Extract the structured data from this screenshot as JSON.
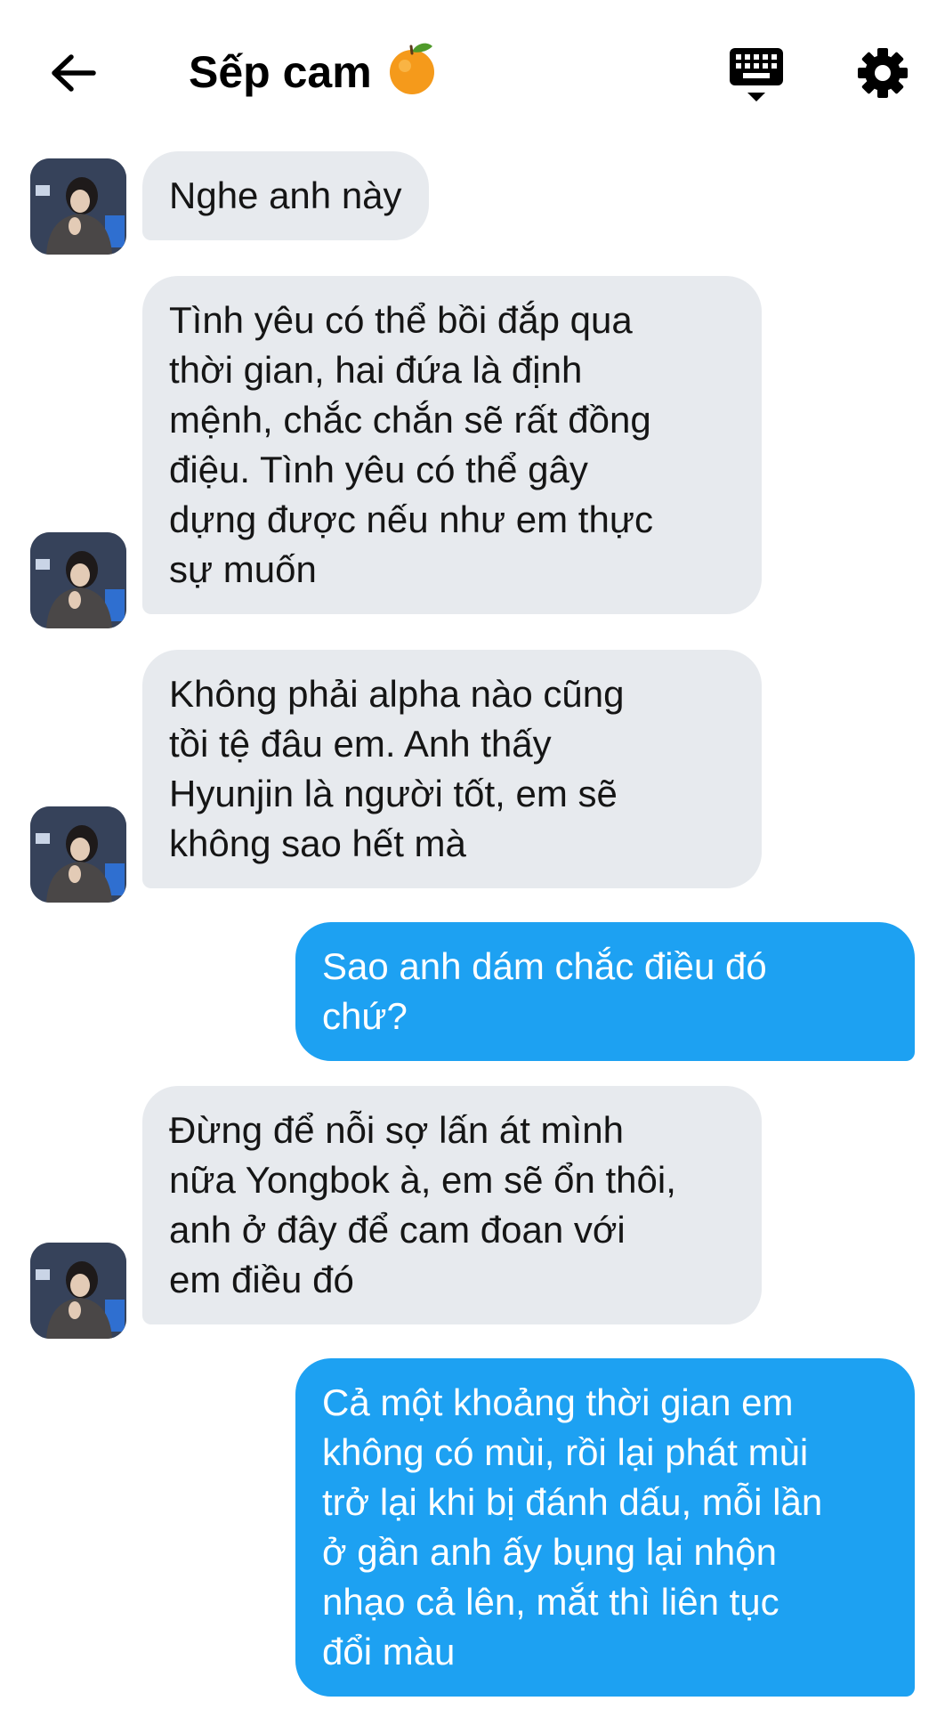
{
  "header": {
    "title": "Sếp cam",
    "back_icon": "arrow-left-icon",
    "emoji_icon": "orange-emoji-icon",
    "keyboard_icon": "keyboard-icon",
    "settings_icon": "gear-icon"
  },
  "colors": {
    "received_bubble": "#e7eaee",
    "sent_bubble": "#1da1f2",
    "background": "#ffffff"
  },
  "messages": [
    {
      "side": "received",
      "text": "Nghe anh này"
    },
    {
      "side": "received",
      "text": "Tình yêu có thể bồi đắp qua\nthời gian, hai đứa là định\nmệnh, chắc chắn sẽ rất đồng\nđiệu. Tình yêu có thể gây\ndựng được nếu như em thực\nsự muốn"
    },
    {
      "side": "received",
      "text": "Không phải alpha nào cũng\ntồi tệ đâu em. Anh thấy\nHyunjin là người tốt, em sẽ\nkhông sao hết mà"
    },
    {
      "side": "sent",
      "text": "Sao anh dám chắc điều đó\nchứ?"
    },
    {
      "side": "received",
      "text": "Đừng để nỗi sợ lấn át mình\nnữa Yongbok à, em sẽ ổn thôi,\nanh ở đây để cam đoan với\nem điều đó"
    },
    {
      "side": "sent",
      "text": "Cả một khoảng thời gian em\nkhông có mùi, rồi lại phát mùi\ntrở lại khi bị đánh dấu, mỗi lần\nở gần anh ấy bụng lại nhộn\nnhạo cả lên, mắt thì liên tục\nđổi màu"
    }
  ]
}
